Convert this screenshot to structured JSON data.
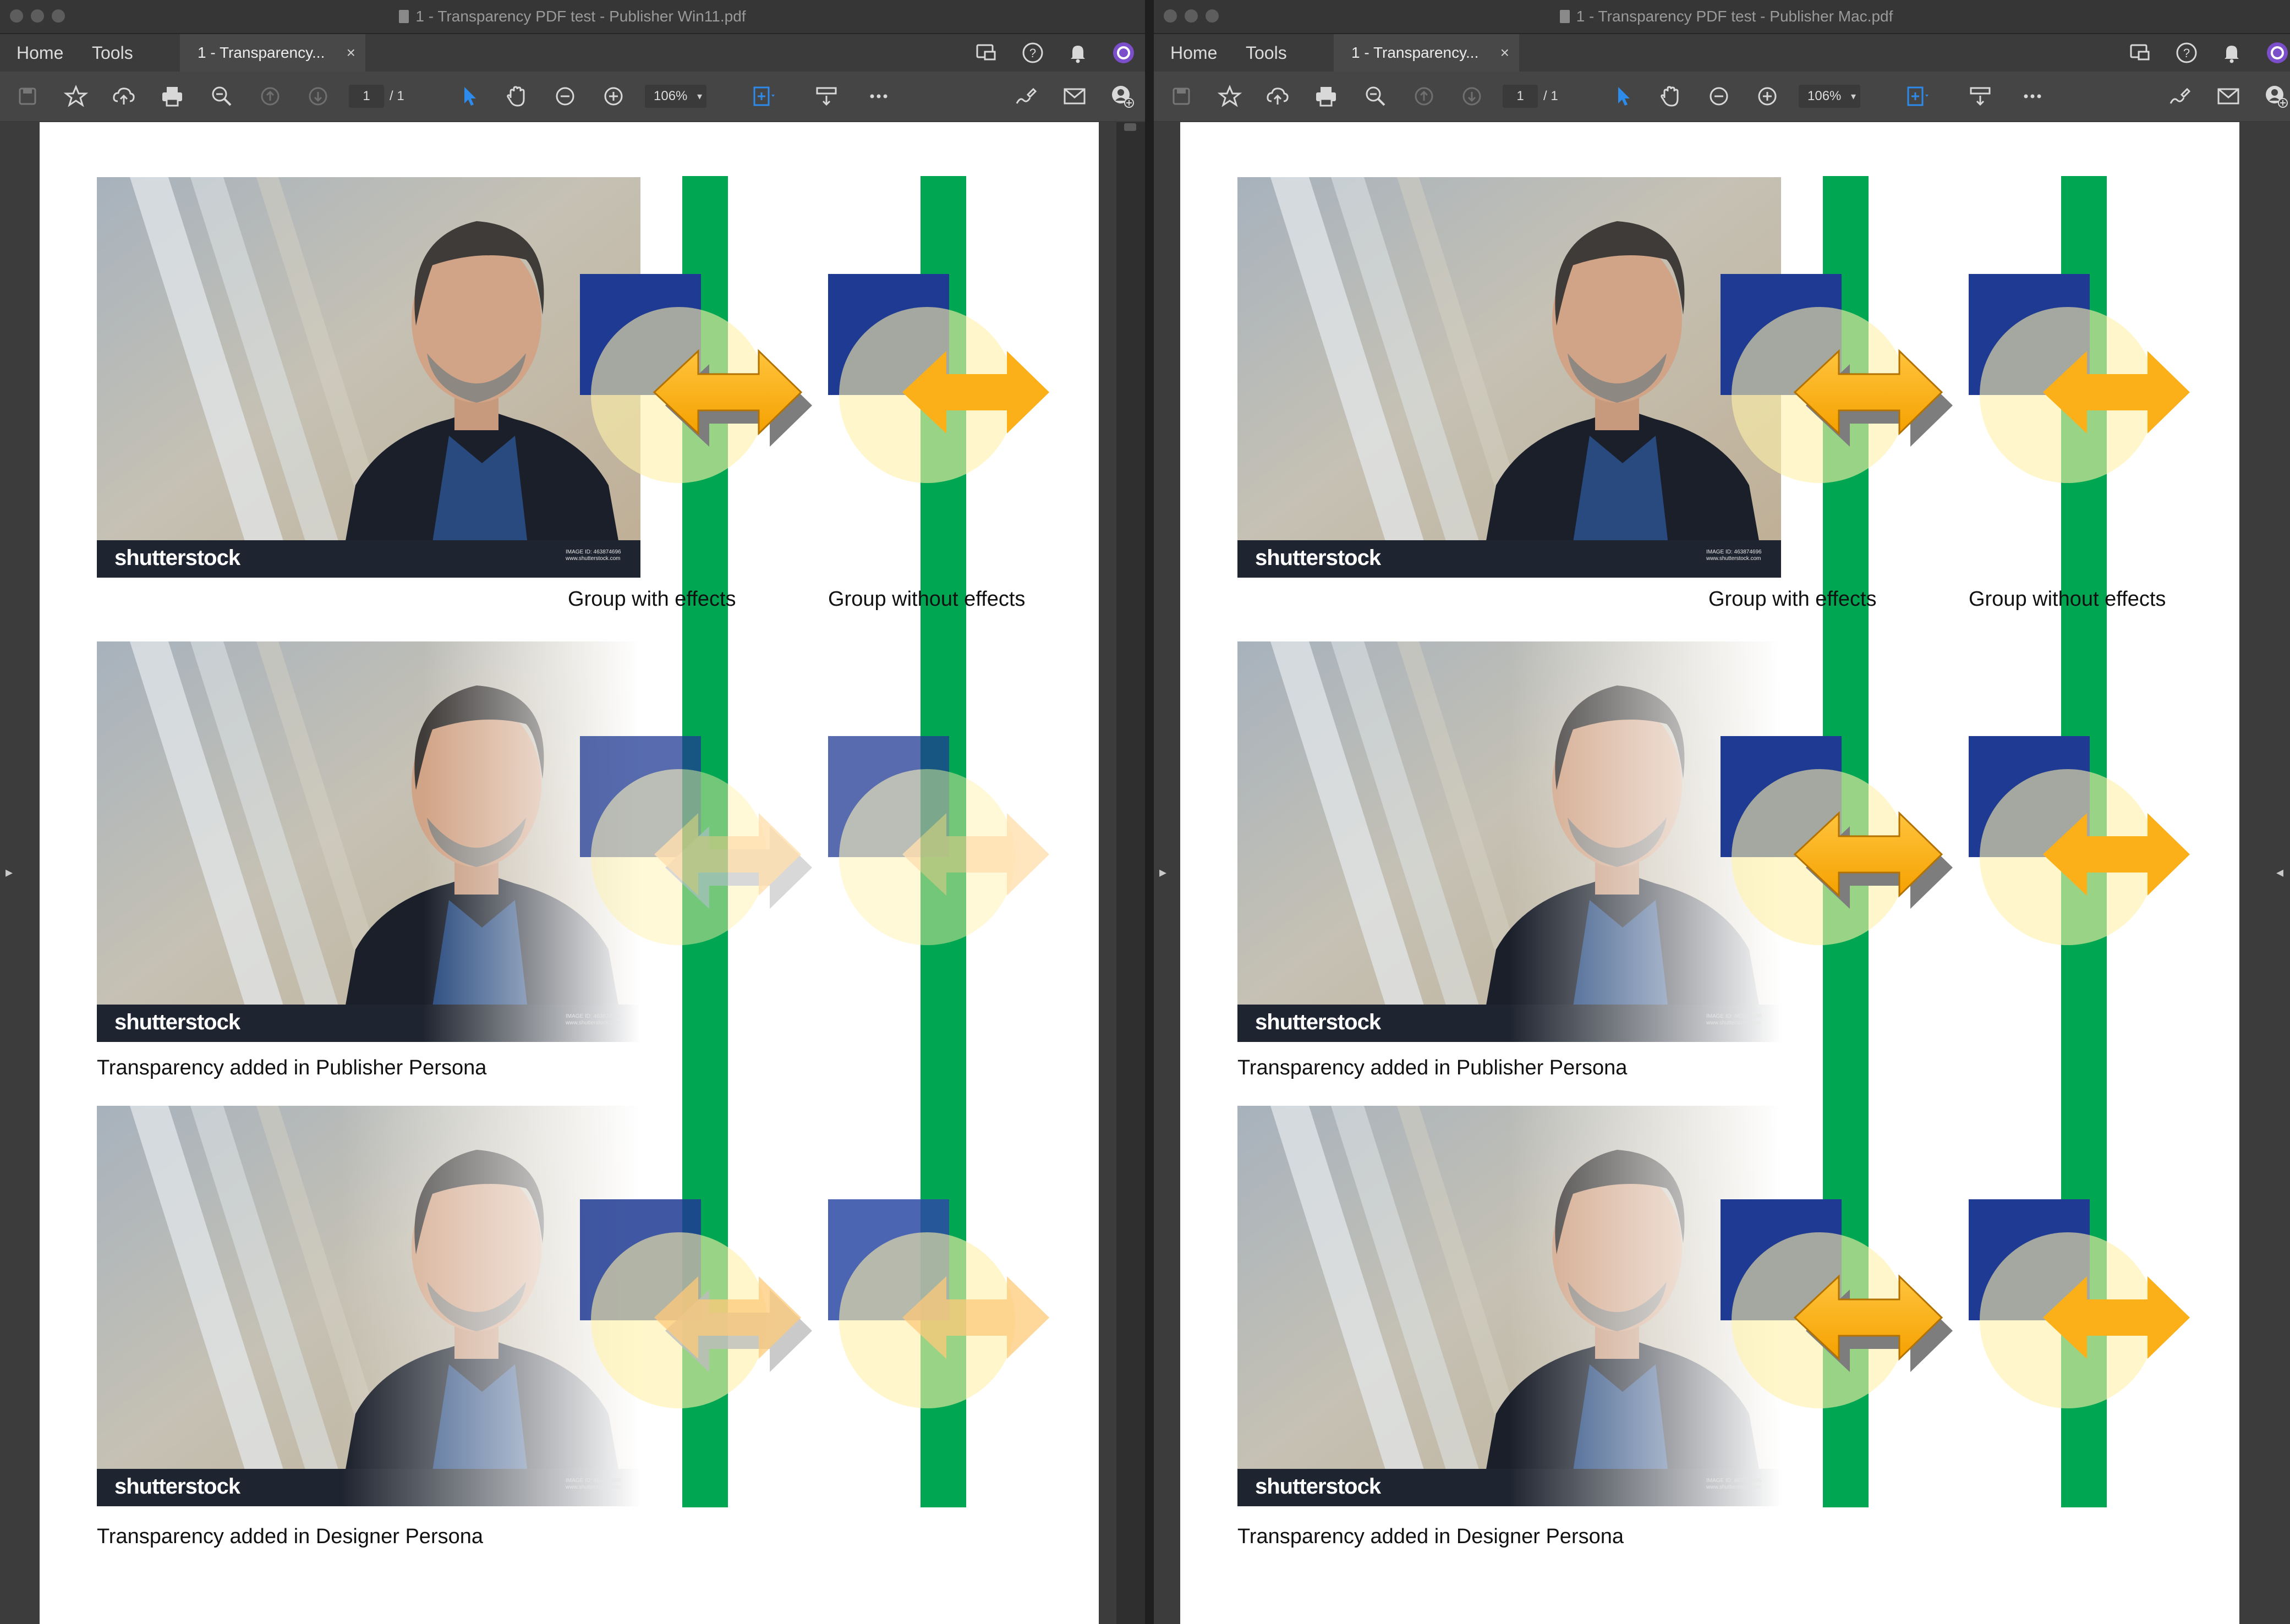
{
  "windows": [
    {
      "title": "1 - Transparency PDF test - Publisher Win11.pdf",
      "nav": {
        "home": "Home",
        "tools": "Tools"
      },
      "doc_tab": {
        "label": "1 - Transparency...",
        "close": "×"
      },
      "toolbar": {
        "page_current": "1",
        "page_total": "/ 1",
        "zoom": "106%"
      },
      "captions": {
        "group_with_effects": "Group with effects",
        "group_without_effects": "Group without effects",
        "publisher_persona": "Transparency added in Publisher Persona",
        "designer_persona": "Transparency added in Designer Persona"
      },
      "photos": [
        {
          "watermark": "shutterstock",
          "image_id": "IMAGE ID: 463874696\nwww.shutterstock.com"
        },
        {
          "watermark": "shutterstock",
          "image_id": "IMAGE ID: 463874696\nwww.shutterstock.com"
        },
        {
          "watermark": "shutterstock",
          "image_id": "IMAGE ID: 463874696\nwww.shutterstock.com"
        }
      ]
    },
    {
      "title": "1 - Transparency PDF test - Publisher Mac.pdf",
      "nav": {
        "home": "Home",
        "tools": "Tools"
      },
      "doc_tab": {
        "label": "1 - Transparency...",
        "close": "×"
      },
      "toolbar": {
        "page_current": "1",
        "page_total": "/ 1",
        "zoom": "106%"
      },
      "captions": {
        "group_with_effects": "Group with effects",
        "group_without_effects": "Group without effects",
        "publisher_persona": "Transparency added in Publisher Persona",
        "designer_persona": "Transparency added in Designer Persona"
      },
      "photos": [
        {
          "watermark": "shutterstock",
          "image_id": "IMAGE ID: 463874696\nwww.shutterstock.com"
        },
        {
          "watermark": "shutterstock",
          "image_id": "IMAGE ID: 463874696\nwww.shutterstock.com"
        },
        {
          "watermark": "shutterstock",
          "image_id": "IMAGE ID: 463874696\nwww.shutterstock.com"
        }
      ]
    }
  ],
  "colors": {
    "green_bar": "#00a651",
    "blue_square": "#1f3a93",
    "yellow_circle": "#fff2a8",
    "orange_arrow": "#fbb01a",
    "account_ring": "#7b4fc9"
  },
  "icons": [
    "save-icon",
    "bookmark-star-icon",
    "upload-cloud-icon",
    "print-icon",
    "zoom-search-icon",
    "prev-page-icon",
    "next-page-icon",
    "select-arrow-icon",
    "hand-icon",
    "zoom-out-icon",
    "zoom-in-icon",
    "fit-page-icon",
    "scroll-mode-icon",
    "more-icon",
    "sign-icon",
    "email-icon",
    "add-user-icon",
    "share-screen-icon",
    "help-icon",
    "bell-icon",
    "account-icon"
  ]
}
